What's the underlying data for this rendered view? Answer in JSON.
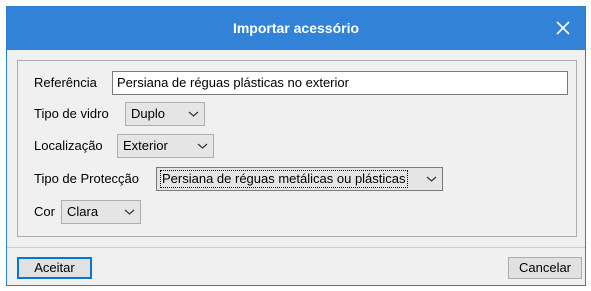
{
  "dialog": {
    "title": "Importar acessório",
    "close_icon": "close-icon"
  },
  "form": {
    "referencia": {
      "label": "Referência",
      "value": "Persiana de réguas plásticas no exterior"
    },
    "tipo_vidro": {
      "label": "Tipo de vidro",
      "value": "Duplo"
    },
    "localizacao": {
      "label": "Localização",
      "value": "Exterior"
    },
    "tipo_proteccao": {
      "label": "Tipo de Protecção",
      "value": "Persiana de réguas metálicas ou plásticas"
    },
    "cor": {
      "label": "Cor",
      "value": "Clara"
    }
  },
  "footer": {
    "accept_label": "Aceitar",
    "cancel_label": "Cancelar"
  },
  "colors": {
    "titlebar": "#3283d7",
    "background": "#f0f0f0",
    "focus_border": "#0078d7"
  }
}
